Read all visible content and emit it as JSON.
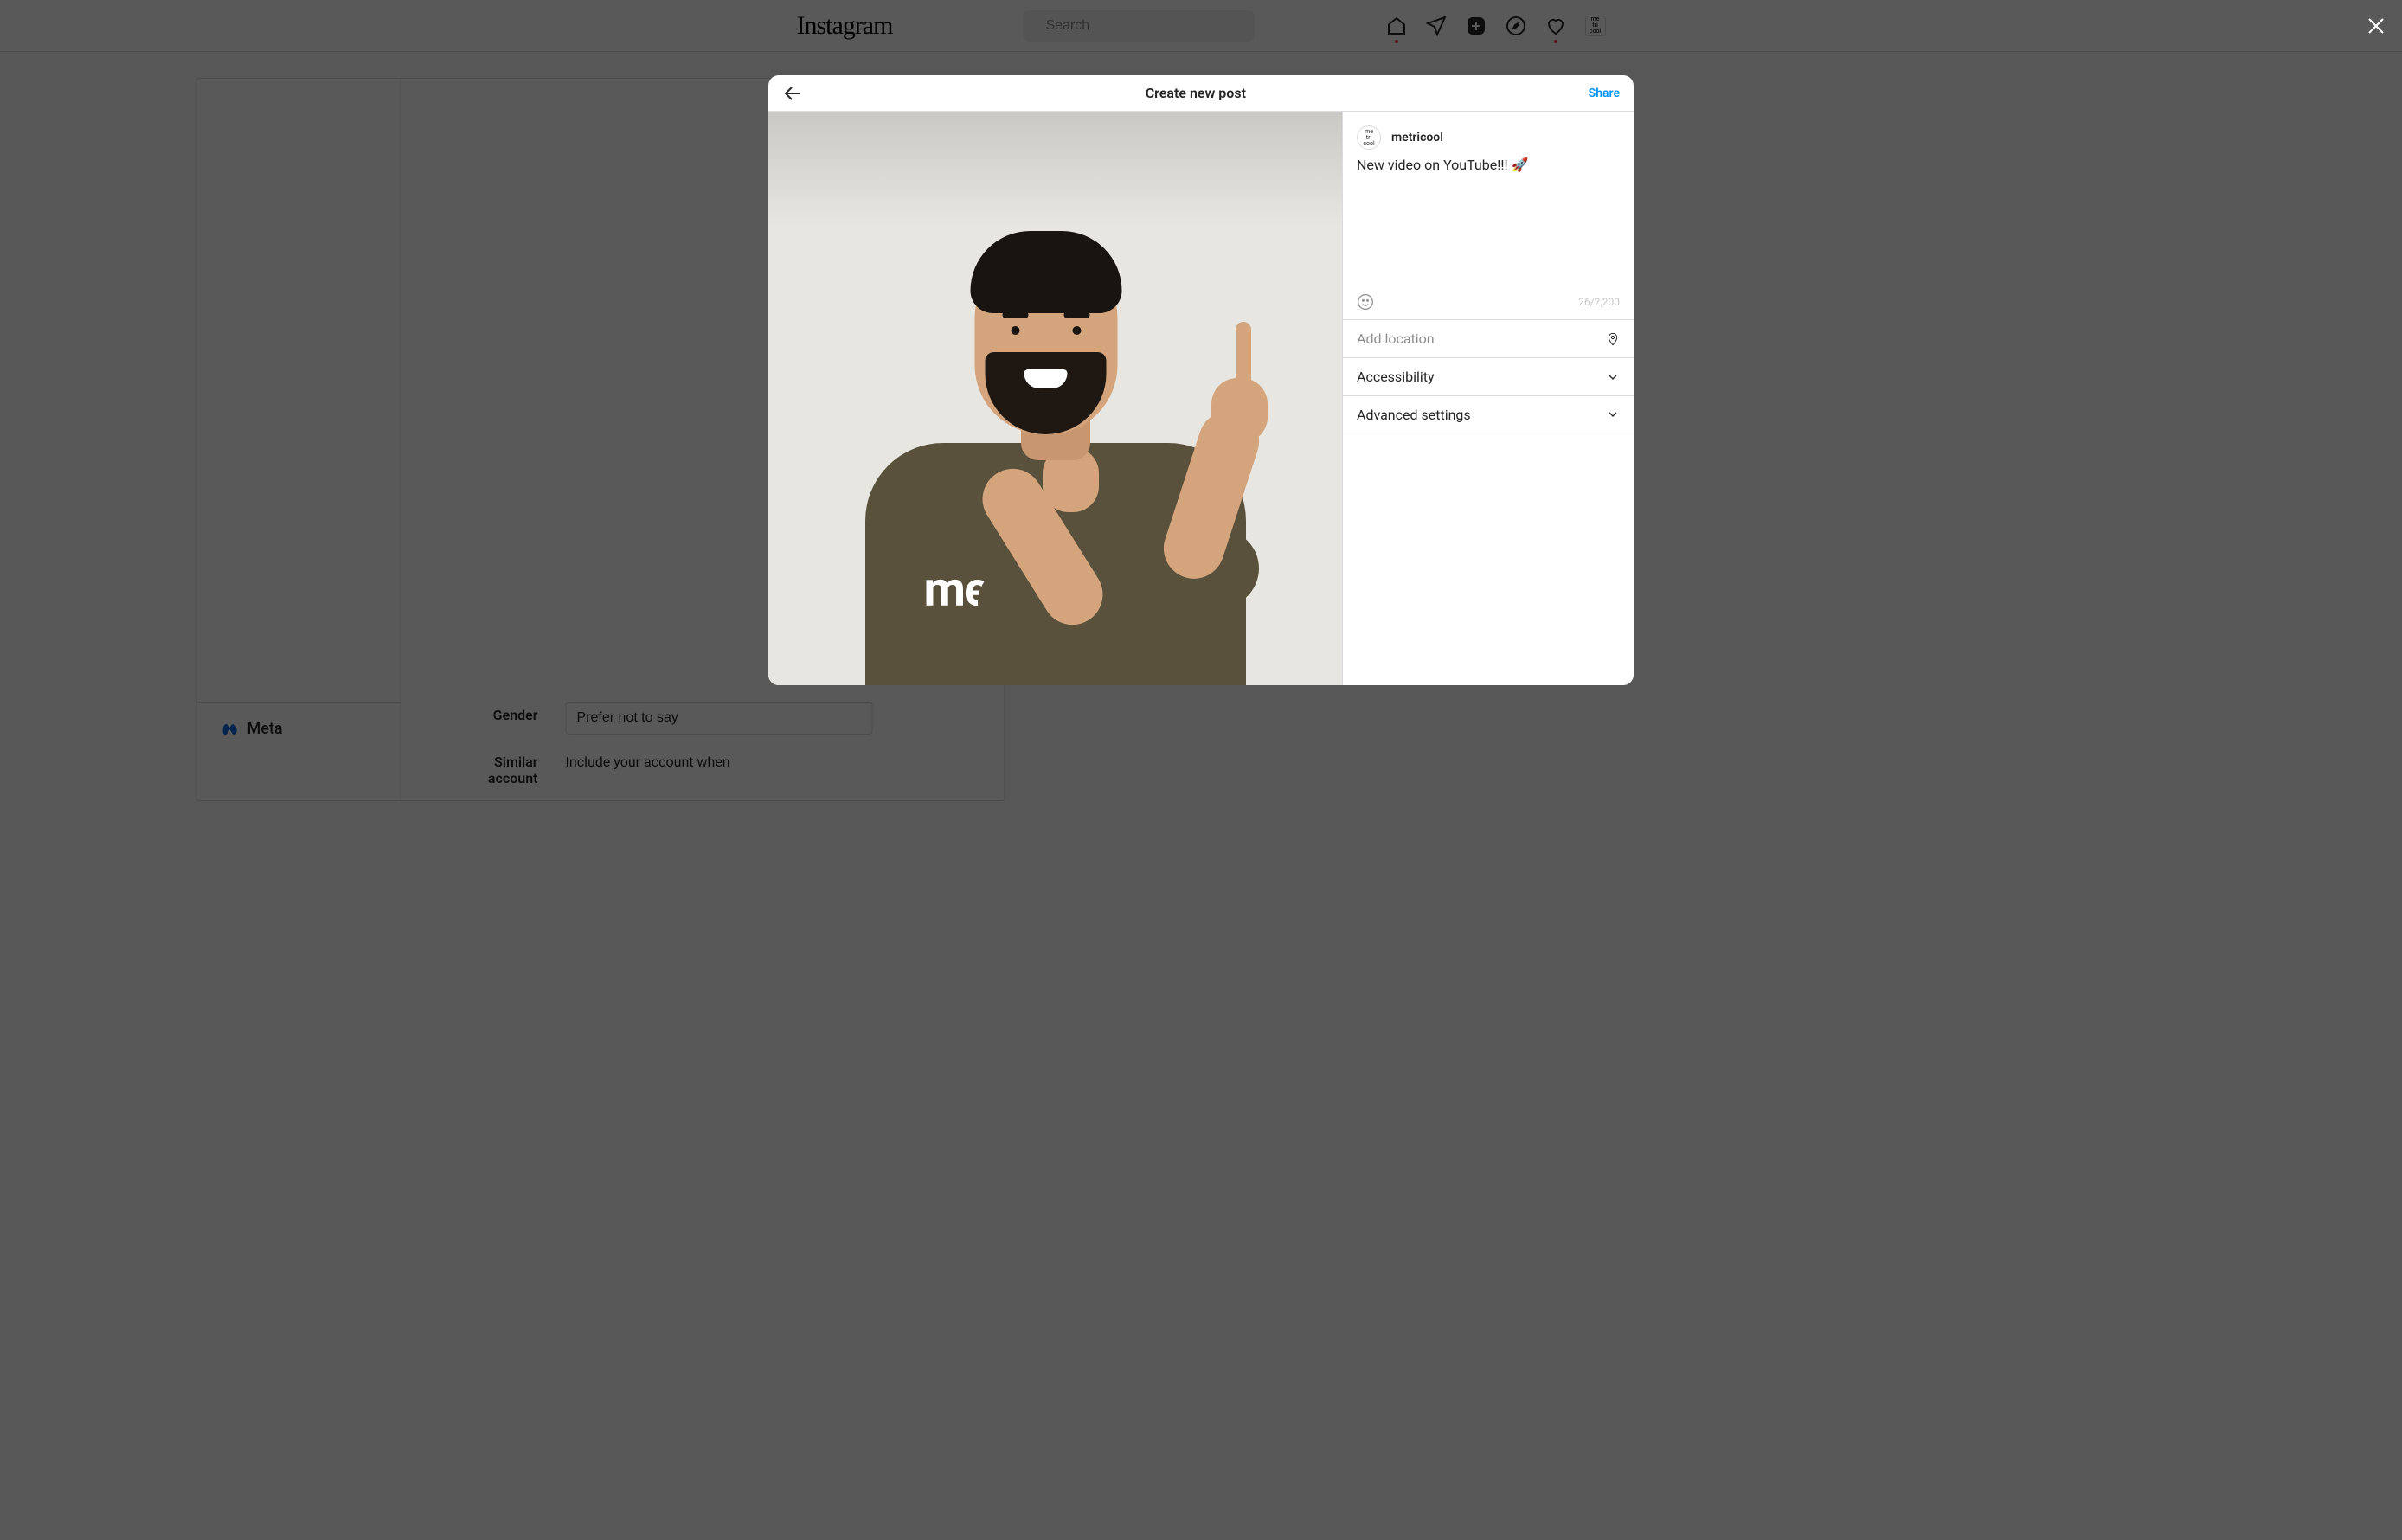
{
  "brand": "Instagram",
  "search": {
    "placeholder": "Search"
  },
  "nav": {
    "avatar_text": "me\ntri\ncool"
  },
  "modal": {
    "title": "Create new post",
    "share": "Share",
    "username": "metricool",
    "avatar_text": "me\ntri\ncool",
    "caption": "New video on YouTube!!! 🚀",
    "char_count": "26/2,200",
    "shirt_text": "met",
    "location_placeholder": "Add location",
    "accessibility": "Accessibility",
    "advanced": "Advanced settings"
  },
  "bg": {
    "gender_label": "Gender",
    "gender_value": "Prefer not to say",
    "similar_label": "Similar account",
    "similar_text": "Include your account when",
    "meta": "Meta"
  }
}
